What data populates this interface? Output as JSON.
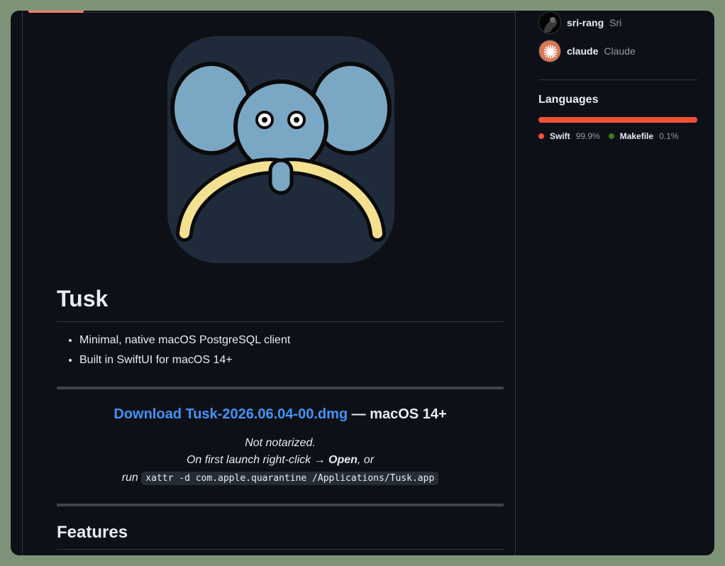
{
  "readme": {
    "title": "Tusk",
    "bullets": [
      "Minimal, native macOS PostgreSQL client",
      "Built in SwiftUI for macOS 14+"
    ],
    "download_link": "Download Tusk-2026.06.04-00.dmg",
    "download_suffix": " — macOS 14+",
    "note_line1": "Not notarized.",
    "note_line2_pre": "On first launch right-click → ",
    "note_line2_bold": "Open",
    "note_line2_post": ", or",
    "note_line3_pre": "run ",
    "note_code": "xattr -d com.apple.quarantine /Applications/Tusk.app",
    "features_heading": "Features"
  },
  "contributors": [
    {
      "login": "sri-rang",
      "name": "Sri"
    },
    {
      "login": "claude",
      "name": "Claude"
    }
  ],
  "languages": {
    "title": "Languages",
    "items": [
      {
        "name": "Swift",
        "percent": "99.9%",
        "value": 99.9,
        "color": "#f05138"
      },
      {
        "name": "Makefile",
        "percent": "0.1%",
        "value": 0.1,
        "color": "#427819"
      }
    ]
  },
  "colors": {
    "background": "#0d1117",
    "link": "#4493f8",
    "logo_bg": "#1f2b3b",
    "logo_elephant": "#7aa8c4",
    "logo_tusk": "#f3e091"
  }
}
